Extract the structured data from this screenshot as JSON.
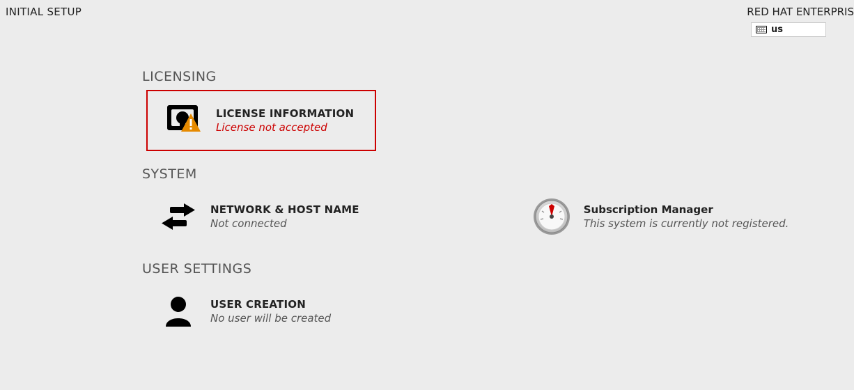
{
  "header": {
    "title": "INITIAL SETUP",
    "distribution": "RED HAT ENTERPRIS",
    "keyboard_layout": "us"
  },
  "sections": {
    "licensing": {
      "heading": "LICENSING",
      "license_info": {
        "title": "LICENSE INFORMATION",
        "status": "License not accepted"
      }
    },
    "system": {
      "heading": "SYSTEM",
      "network": {
        "title": "NETWORK & HOST NAME",
        "status": "Not connected"
      },
      "subscription": {
        "title": "Subscription Manager",
        "status": "This system is currently not registered."
      }
    },
    "user_settings": {
      "heading": "USER SETTINGS",
      "user_creation": {
        "title": "USER CREATION",
        "status": "No user will be created"
      }
    }
  }
}
